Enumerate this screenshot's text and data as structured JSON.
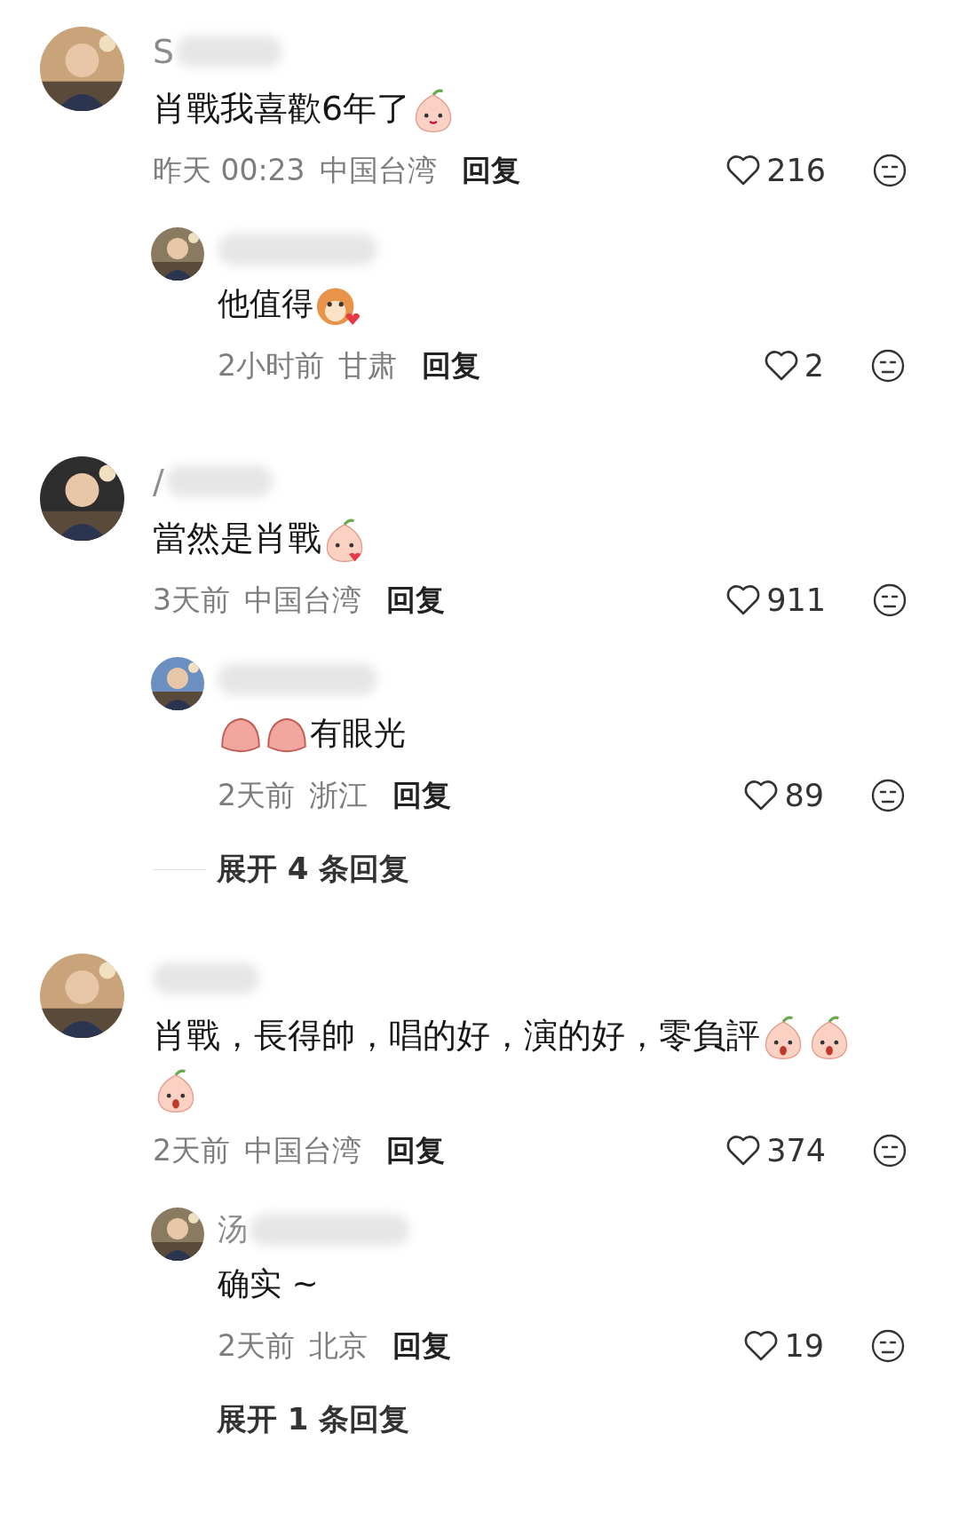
{
  "comments": [
    {
      "name": "S",
      "avatar": {
        "kind": "picture"
      },
      "content": [
        {
          "kind": "text",
          "text": "肖戰我喜歡6年了"
        },
        {
          "kind": "peach-smile"
        }
      ],
      "time": "昨天 00:23",
      "location": "中国台湾",
      "reply_label": "回复",
      "likes": "216",
      "replies": [
        {
          "avatar": {
            "kind": "picture"
          },
          "content": [
            {
              "kind": "text",
              "text": "他值得"
            },
            {
              "kind": "cat-heart"
            }
          ],
          "time": "2小时前",
          "location": "甘肃",
          "reply_label": "回复",
          "likes": "2"
        }
      ]
    },
    {
      "name": "/",
      "avatar": {
        "kind": "picture"
      },
      "content": [
        {
          "kind": "text",
          "text": "當然是肖戰"
        },
        {
          "kind": "peach-kiss"
        }
      ],
      "time": "3天前",
      "location": "中国台湾",
      "reply_label": "回复",
      "likes": "911",
      "replies": [
        {
          "avatar": {
            "kind": "picture"
          },
          "content": [
            {
              "kind": "peach-bun"
            },
            {
              "kind": "peach-bun"
            },
            {
              "kind": "text",
              "text": "有眼光"
            }
          ],
          "time": "2天前",
          "location": "浙江",
          "reply_label": "回复",
          "likes": "89"
        }
      ],
      "expand": {
        "label": "展开 4 条回复",
        "divider": true
      }
    },
    {
      "avatar": {
        "kind": "picture"
      },
      "content": [
        {
          "kind": "text",
          "text": "肖戰，長得帥，唱的好，演的好，零負評"
        },
        {
          "kind": "peach-shock"
        },
        {
          "kind": "peach-shock"
        },
        {
          "kind": "peach-shock"
        }
      ],
      "time": "2天前",
      "location": "中国台湾",
      "reply_label": "回复",
      "likes": "374",
      "replies": [
        {
          "name": "汤",
          "avatar": {
            "kind": "picture"
          },
          "content": [
            {
              "kind": "text",
              "text": "确实 ~"
            }
          ],
          "time": "2天前",
          "location": "北京",
          "reply_label": "回复",
          "likes": "19"
        }
      ],
      "expand": {
        "label": "展开 1 条回复"
      }
    }
  ]
}
